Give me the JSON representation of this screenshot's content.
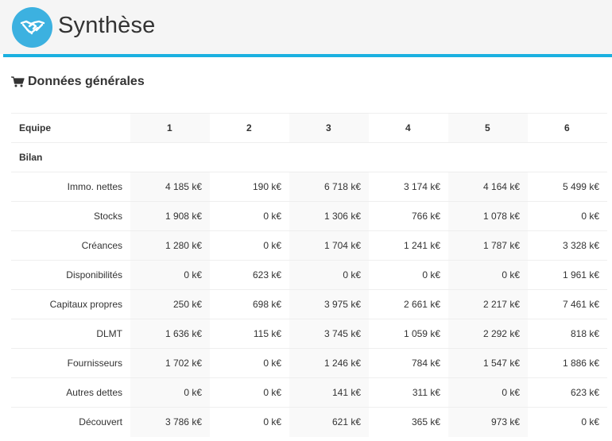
{
  "header": {
    "title": "Synthèse",
    "logo_icon": "handshake-icon"
  },
  "colors": {
    "accent": "#1ab0e0",
    "logo_bg": "#3cb1e0"
  },
  "section": {
    "title": "Données générales",
    "icon": "cart-icon"
  },
  "table": {
    "header_label": "Equipe",
    "teams": [
      "1",
      "2",
      "3",
      "4",
      "5",
      "6"
    ],
    "group_label": "Bilan",
    "rows": [
      {
        "label": "Immo. nettes",
        "values": [
          "4 185 k€",
          "190 k€",
          "6 718 k€",
          "3 174 k€",
          "4 164 k€",
          "5 499 k€"
        ]
      },
      {
        "label": "Stocks",
        "values": [
          "1 908 k€",
          "0 k€",
          "1 306 k€",
          "766 k€",
          "1 078 k€",
          "0 k€"
        ]
      },
      {
        "label": "Créances",
        "values": [
          "1 280 k€",
          "0 k€",
          "1 704 k€",
          "1 241 k€",
          "1 787 k€",
          "3 328 k€"
        ]
      },
      {
        "label": "Disponibilités",
        "values": [
          "0 k€",
          "623 k€",
          "0 k€",
          "0 k€",
          "0 k€",
          "1 961 k€"
        ]
      },
      {
        "label": "Capitaux propres",
        "values": [
          "250 k€",
          "698 k€",
          "3 975 k€",
          "2 661 k€",
          "2 217 k€",
          "7 461 k€"
        ]
      },
      {
        "label": "DLMT",
        "values": [
          "1 636 k€",
          "115 k€",
          "3 745 k€",
          "1 059 k€",
          "2 292 k€",
          "818 k€"
        ]
      },
      {
        "label": "Fournisseurs",
        "values": [
          "1 702 k€",
          "0 k€",
          "1 246 k€",
          "784 k€",
          "1 547 k€",
          "1 886 k€"
        ]
      },
      {
        "label": "Autres dettes",
        "values": [
          "0 k€",
          "0 k€",
          "141 k€",
          "311 k€",
          "0 k€",
          "623 k€"
        ]
      },
      {
        "label": "Découvert",
        "values": [
          "3 786 k€",
          "0 k€",
          "621 k€",
          "365 k€",
          "973 k€",
          "0 k€"
        ]
      }
    ]
  }
}
